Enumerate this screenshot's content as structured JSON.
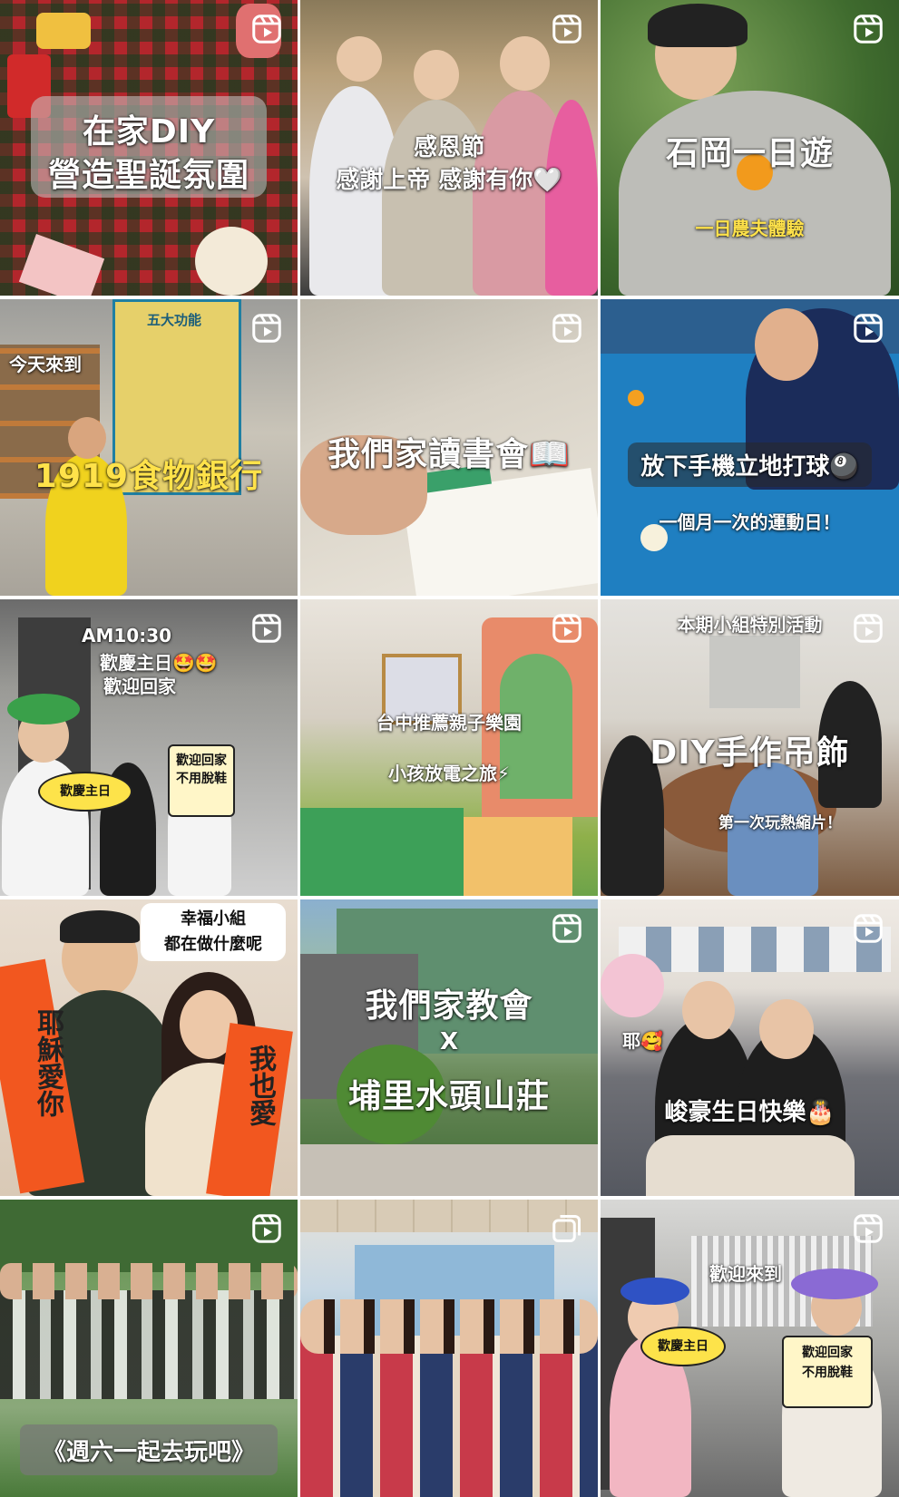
{
  "tiles": [
    {
      "lines": [
        "在家DIY",
        "營造聖誕氛圍"
      ],
      "type": "reel"
    },
    {
      "lines": [
        "感恩節",
        "感謝上帝 感謝有你🤍"
      ],
      "type": "reel"
    },
    {
      "lines": [
        "石岡一日遊",
        "一日農夫體驗"
      ],
      "type": "reel"
    },
    {
      "lines": [
        "今天來到",
        "1919食物銀行",
        "五大功能"
      ],
      "type": "reel"
    },
    {
      "lines": [
        "我們家讀書會📖"
      ],
      "type": "reel"
    },
    {
      "lines": [
        "放下手機立地打球🎱",
        "一個月一次的運動日！"
      ],
      "type": "reel"
    },
    {
      "lines": [
        "AM10:30",
        "歡慶主日🤩🤩",
        "歡迎回家",
        "歡慶主日",
        "歡迎回家",
        "不用脫鞋"
      ],
      "type": "reel"
    },
    {
      "lines": [
        "台中推薦親子樂園",
        "小孩放電之旅⚡"
      ],
      "type": "reel"
    },
    {
      "lines": [
        "本期小組特別活動",
        "DIY手作吊飾",
        "第一次玩熱縮片！"
      ],
      "type": "reel"
    },
    {
      "lines": [
        "幸福小組",
        "都在做什麼呢",
        "耶穌愛你",
        "我也愛"
      ],
      "type": "reel"
    },
    {
      "lines": [
        "我們家教會",
        "X",
        "埔里水頭山莊"
      ],
      "type": "reel"
    },
    {
      "lines": [
        "耶🥰",
        "峻豪生日快樂🎂"
      ],
      "type": "reel"
    },
    {
      "lines": [
        "《週六一起去玩吧》"
      ],
      "type": "reel"
    },
    {
      "lines": [],
      "type": "carousel"
    },
    {
      "lines": [
        "歡迎來到",
        "歡慶主日",
        "歡迎回家",
        "不用脫鞋"
      ],
      "type": "reel"
    }
  ],
  "icons": {
    "reel": "reels-icon",
    "carousel": "carousel-icon"
  }
}
